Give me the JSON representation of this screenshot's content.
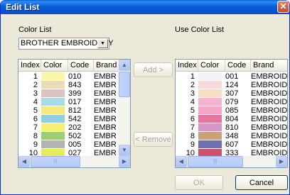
{
  "window": {
    "title": "Edit List"
  },
  "labels": {
    "color_list": "Color List",
    "use_color_list": "Use Color List"
  },
  "combo": {
    "value": "BROTHER EMBROIDERY"
  },
  "columns": [
    "Index",
    "Color",
    "Code",
    "Brand"
  ],
  "left_rows": [
    {
      "index": "1",
      "color": "#fbf7a6",
      "code": "010",
      "brand": "EMBRI"
    },
    {
      "index": "2",
      "color": "#ebdcb8",
      "code": "843",
      "brand": "EMBRI"
    },
    {
      "index": "3",
      "color": "#d9c4c2",
      "code": "399",
      "brand": "EMBRI"
    },
    {
      "index": "4",
      "color": "#a7dbe8",
      "code": "017",
      "brand": "EMBRI"
    },
    {
      "index": "5",
      "color": "#f6e77f",
      "code": "812",
      "brand": "EMBRI"
    },
    {
      "index": "6",
      "color": "#8fcfe1",
      "code": "542",
      "brand": "EMBRI"
    },
    {
      "index": "7",
      "color": "#f2ef73",
      "code": "202",
      "brand": "EMBRI"
    },
    {
      "index": "8",
      "color": "#9ccf73",
      "code": "502",
      "brand": "EMBRI"
    },
    {
      "index": "9",
      "color": "#b3b3b3",
      "code": "005",
      "brand": "EMBRI"
    },
    {
      "index": "10",
      "color": "#e3ef55",
      "code": "027",
      "brand": "EMBRI"
    }
  ],
  "right_rows": [
    {
      "index": "1",
      "color": "#f3f3f3",
      "code": "001",
      "brand": "EMBROID"
    },
    {
      "index": "2",
      "color": "#f9d9dc",
      "code": "124",
      "brand": "EMBROID"
    },
    {
      "index": "3",
      "color": "#f7ddc2",
      "code": "307",
      "brand": "EMBROID"
    },
    {
      "index": "4",
      "color": "#f5b2cf",
      "code": "079",
      "brand": "EMBROID"
    },
    {
      "index": "5",
      "color": "#f3a6c6",
      "code": "085",
      "brand": "EMBROID"
    },
    {
      "index": "6",
      "color": "#e4759c",
      "code": "804",
      "brand": "EMBROID"
    },
    {
      "index": "7",
      "color": "#d798c8",
      "code": "810",
      "brand": "EMBROID"
    },
    {
      "index": "8",
      "color": "#cba178",
      "code": "348",
      "brand": "EMBROID"
    },
    {
      "index": "9",
      "color": "#6d6fae",
      "code": "607",
      "brand": "EMBROID"
    },
    {
      "index": "10",
      "color": "#cf4f6c",
      "code": "333",
      "brand": "EMBROID"
    }
  ],
  "buttons": {
    "add": "Add >",
    "remove": "< Remove",
    "ok": "OK",
    "cancel": "Cancel"
  },
  "icons": {
    "close": "close-icon",
    "dropdown": "chevron-down-icon"
  }
}
